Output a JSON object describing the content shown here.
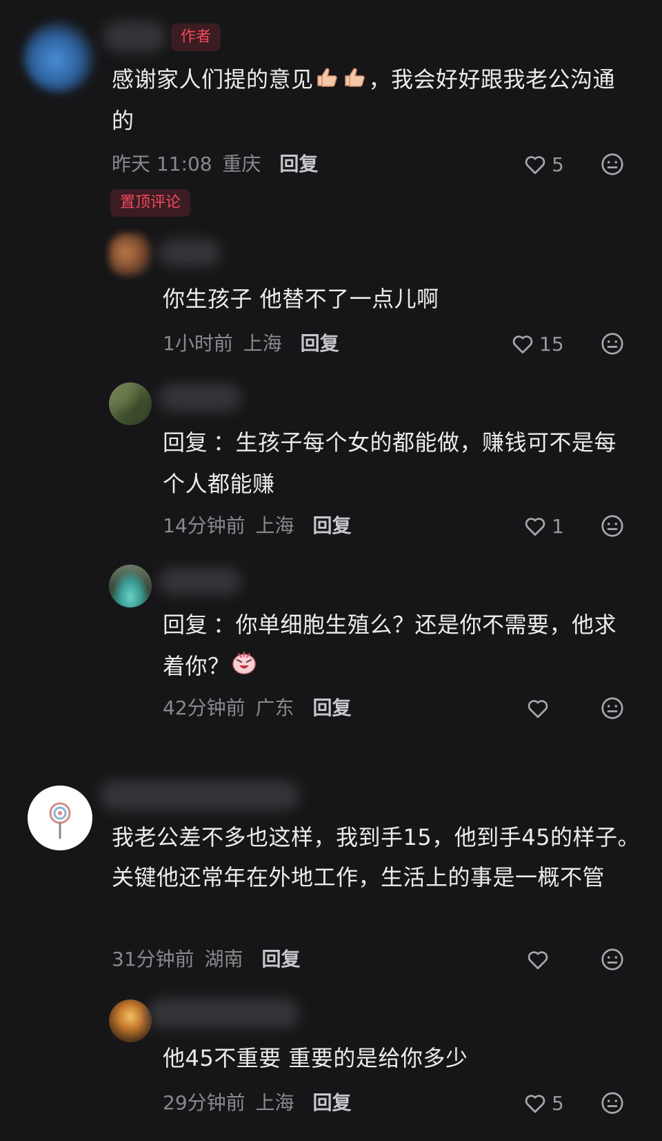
{
  "comments": [
    {
      "tag": "作者",
      "text_a": "感谢家人们提的意见",
      "text_b": "，我会好好跟我老公沟通的",
      "time": "昨天 11:08",
      "location": "重庆",
      "reply_label": "回复",
      "likes": "5",
      "pinned_tag": "置顶评论"
    },
    {
      "text": "你生孩子 他替不了一点儿啊",
      "time": "1小时前",
      "location": "上海",
      "reply_label": "回复",
      "likes": "15"
    },
    {
      "reply_prefix": "回复",
      "text": "：生孩子每个女的都能做，赚钱可不是每个人都能赚",
      "time": "14分钟前",
      "location": "上海",
      "reply_label": "回复",
      "likes": "1"
    },
    {
      "reply_prefix": "回复",
      "text": "：你单细胞生殖么？还是你不需要，他求着你？",
      "time": "42分钟前",
      "location": "广东",
      "reply_label": "回复",
      "likes": ""
    },
    {
      "text": "我老公差不多也这样，我到手15，他到手45的样子。关键他还常年在外地工作，生活上的事是一概不管",
      "time": "31分钟前",
      "location": "湖南",
      "reply_label": "回复",
      "likes": ""
    },
    {
      "text": "他45不重要 重要的是给你多少",
      "time": "29分钟前",
      "location": "上海",
      "reply_label": "回复",
      "likes": "5"
    }
  ],
  "colors": {
    "background": "#161618",
    "tag_text": "#f2485e",
    "tag_bg": "#3a1c22",
    "meta": "#8a8a8e"
  },
  "icons": {
    "like": "heart-outline-icon",
    "react": "face-icon",
    "thumbs": "thumbs-up-emoji",
    "laugh": "laughing-face-emoji"
  }
}
